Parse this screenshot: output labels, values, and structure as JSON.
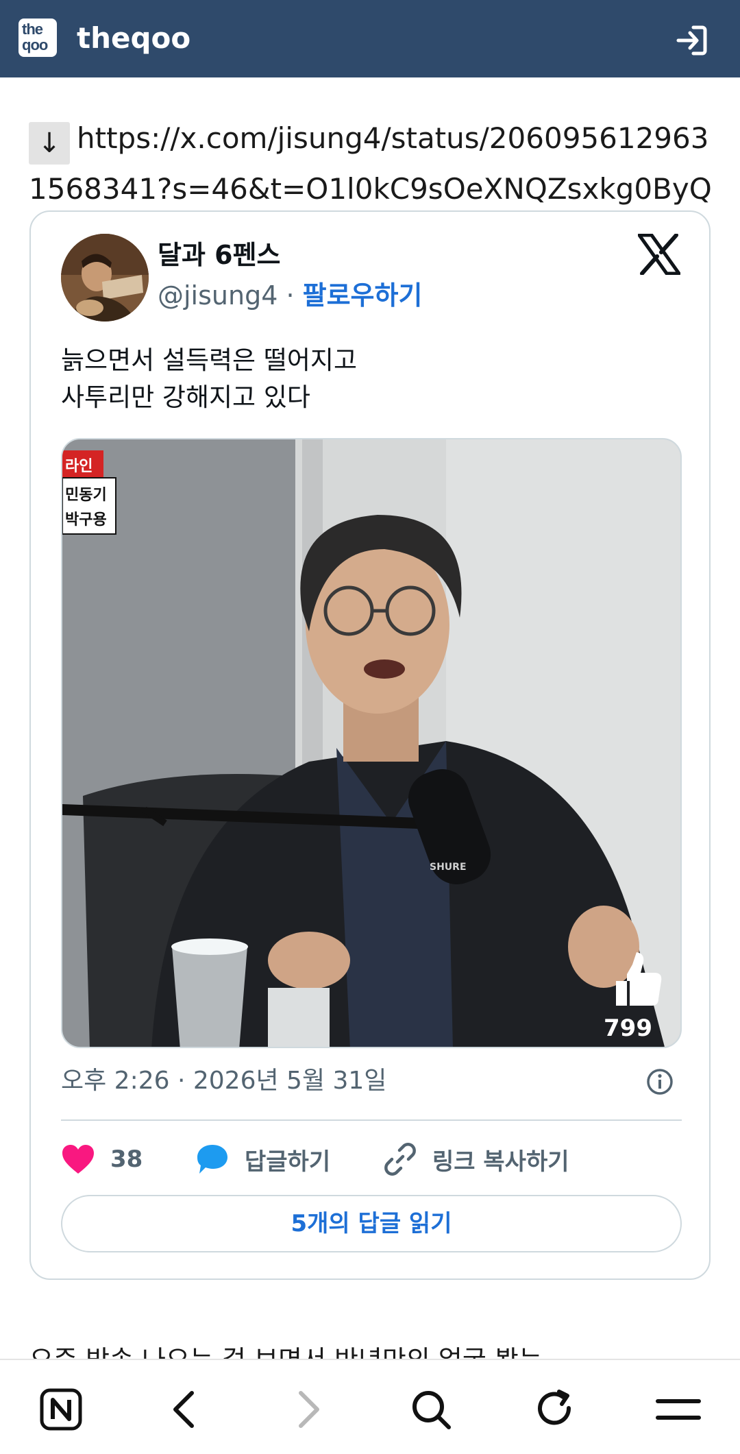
{
  "header": {
    "logo_text": "the qoo",
    "brand": "theqoo",
    "login_icon": "login-icon"
  },
  "link": {
    "icon": "down-arrow-icon",
    "arrow": "↓",
    "url": "https://x.com/jisung4/status/2060956129631568341?s=46&t=O1l0kC9sOeXNQZsxkg0ByQ"
  },
  "tweet": {
    "display_name": "달과 6펜스",
    "handle": "@jisung4",
    "separator": " · ",
    "follow_label": "팔로우하기",
    "text": "늙으면서 설득력은 떨어지고\n사투리만 강해지고 있다",
    "media": {
      "overlay_badge_lines": [
        "라인",
        "민동기",
        "박구용"
      ],
      "like_count_overlay": "799",
      "mic_brand": "SHURE"
    },
    "timestamp": "오후 2:26 · 2026년 5월 31일",
    "likes": "38",
    "reply_label": "답글하기",
    "copy_link_label": "링크 복사하기",
    "read_replies_label": "5개의 답글 읽기"
  },
  "body_cutoff_text": "오준 방송 나오는 걸 보면서 반년만의 얼굴 봤는",
  "colors": {
    "header_bg": "#2f4a6b",
    "link_blue": "#1d6fd6",
    "heart": "#f91880",
    "reply_blue": "#1d9bf0",
    "muted": "#536471",
    "border": "#cfd9de"
  },
  "bottom_nav": {
    "items": [
      "naver-n-icon",
      "back-icon",
      "forward-icon",
      "search-icon",
      "refresh-icon",
      "menu-icon"
    ]
  }
}
